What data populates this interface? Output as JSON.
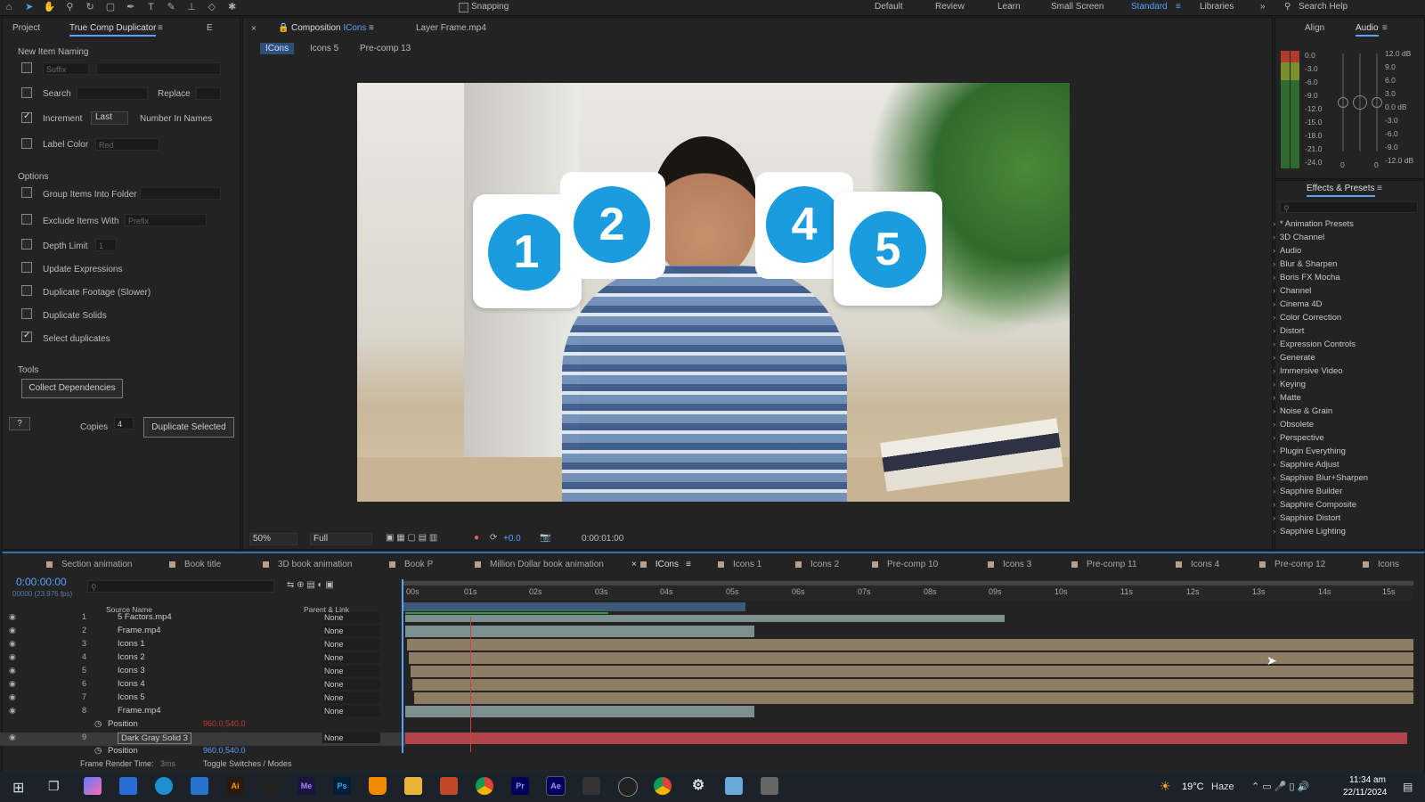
{
  "workspaces": [
    "Default",
    "Review",
    "Learn",
    "Small Screen",
    "Standard",
    "Libraries"
  ],
  "search_help": "Search Help",
  "snapping": "Snapping",
  "left_tabs": {
    "project": "Project",
    "dup": "True Comp Duplicator",
    "e": "E"
  },
  "dup": {
    "new_item_naming": "New Item Naming",
    "suffix_ph": "Suffix",
    "search": "Search",
    "replace": "Replace",
    "increment": "Increment",
    "last": "Last",
    "number_in_names": "Number In Names",
    "label_color": "Label Color",
    "red": "Red",
    "options": "Options",
    "group": "Group Items Into Folder",
    "exclude": "Exclude Items With",
    "prefix": "Prefix",
    "depth": "Depth Limit",
    "depth_val": "1",
    "update_expr": "Update Expressions",
    "dup_footage": "Duplicate Footage (Slower)",
    "dup_solids": "Duplicate Solids",
    "select_dups": "Select duplicates",
    "tools": "Tools",
    "collect": "Collect Dependencies",
    "help": "?",
    "copies": "Copies",
    "copies_val": "4",
    "dup_selected": "Duplicate Selected"
  },
  "comp": {
    "tab_prefix": "Composition",
    "tab_name": "ICons",
    "layer_tab": "Layer Frame.mp4",
    "crumbs": [
      "ICons",
      "Icons 5",
      "Pre-comp 13"
    ],
    "zoom": "50%",
    "res": "Full",
    "exposure": "+0.0",
    "timecode": "0:00:01:00",
    "icons": [
      "1",
      "2",
      "4",
      "5"
    ]
  },
  "right": {
    "align": "Align",
    "audio": "Audio",
    "db_left": [
      "0.0",
      "-3.0",
      "-6.0",
      "-9.0",
      "-12.0",
      "-15.0",
      "-18.0",
      "-21.0",
      "-24.0"
    ],
    "db_right": [
      "12.0 dB",
      "9.0",
      "6.0",
      "3.0",
      "0.0 dB",
      "-3.0",
      "-6.0",
      "-9.0",
      "-12.0 dB"
    ],
    "meter_zero_a": "0",
    "meter_zero_b": "0",
    "effects_title": "Effects & Presets",
    "effects": [
      "* Animation Presets",
      "3D Channel",
      "Audio",
      "Blur & Sharpen",
      "Boris FX Mocha",
      "Channel",
      "Cinema 4D",
      "Color Correction",
      "Distort",
      "Expression Controls",
      "Generate",
      "Immersive Video",
      "Keying",
      "Matte",
      "Noise & Grain",
      "Obsolete",
      "Perspective",
      "Plugin Everything",
      "Sapphire Adjust",
      "Sapphire Blur+Sharpen",
      "Sapphire Builder",
      "Sapphire Composite",
      "Sapphire Distort",
      "Sapphire Lighting"
    ]
  },
  "timeline": {
    "tabs": [
      "Section animation",
      "Book title",
      "3D book animation",
      "Book P",
      "Million Dollar book animation",
      "ICons",
      "Icons 1",
      "Icons 2",
      "Pre-comp 10",
      "Icons 3",
      "Pre-comp 11",
      "Icons 4",
      "Pre-comp 12",
      "Icons"
    ],
    "timecode": "0:00:00:00",
    "fps": "00000 (23.976 fps)",
    "col_source": "Source Name",
    "col_parent": "Parent & Link",
    "ruler": [
      "00s",
      "01s",
      "02s",
      "03s",
      "04s",
      "05s",
      "06s",
      "07s",
      "08s",
      "09s",
      "10s",
      "11s",
      "12s",
      "13s",
      "14s",
      "15s"
    ],
    "layers": [
      {
        "num": "1",
        "name": "5 Factors.mp4",
        "parent": "None"
      },
      {
        "num": "2",
        "name": "Frame.mp4",
        "parent": "None"
      },
      {
        "num": "3",
        "name": "Icons 1",
        "parent": "None"
      },
      {
        "num": "4",
        "name": "Icons 2",
        "parent": "None"
      },
      {
        "num": "5",
        "name": "Icons 3",
        "parent": "None"
      },
      {
        "num": "6",
        "name": "Icons 4",
        "parent": "None"
      },
      {
        "num": "7",
        "name": "Icons 5",
        "parent": "None"
      },
      {
        "num": "8",
        "name": "Frame.mp4",
        "parent": "None"
      }
    ],
    "position_label": "Position",
    "pos_val_red": "960.0,540.0",
    "layer9": {
      "num": "9",
      "name": "Dark Gray Solid 3",
      "parent": "None"
    },
    "pos_val_blue": "960.0,540.0",
    "render_time": "Frame Render Time:",
    "render_val": "3ms",
    "toggle": "Toggle Switches / Modes"
  },
  "taskbar": {
    "weather": "19°C",
    "haze": "Haze",
    "time": "11:34 am",
    "date": "22/11/2024",
    "apps": [
      "Ai",
      "Me",
      "Ps",
      "Pr",
      "Ae"
    ]
  }
}
